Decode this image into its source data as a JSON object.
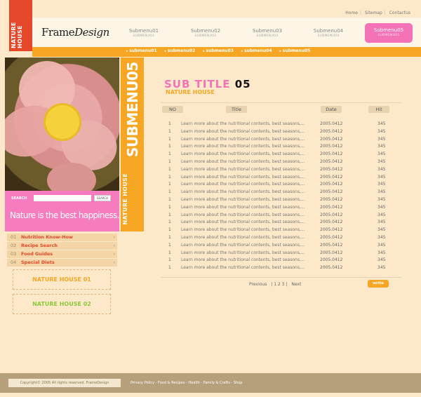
{
  "top_links": [
    "Home",
    "Sitemap",
    "Contactus"
  ],
  "brand_vertical": "NATURE HOUSE",
  "logo": {
    "part1": "Frame",
    "part2": "Design"
  },
  "nav": [
    {
      "label": "Submenu01",
      "sub": "SUBMENU01"
    },
    {
      "label": "Submenu02",
      "sub": "SUBMENU02"
    },
    {
      "label": "Submenu03",
      "sub": "SUBMENU03"
    },
    {
      "label": "Submenu04",
      "sub": "SUBMENU04"
    },
    {
      "label": "Submenu05",
      "sub": "SUBMENU05"
    }
  ],
  "subnav": [
    "submenu01",
    "submenu02",
    "submenu03",
    "submenu04",
    "submenu05"
  ],
  "search": {
    "label": "SEARCH",
    "button": "SEARCH",
    "placeholder": ""
  },
  "tagline": "Nature is the best happiness.",
  "side_banner": {
    "big": "SUBMENU05",
    "small": "NATURE HOUSE"
  },
  "left_menu": [
    {
      "num": "01",
      "label": "Nutrition Know-How"
    },
    {
      "num": "02",
      "label": "Recipe Search"
    },
    {
      "num": "03",
      "label": "Food Guides"
    },
    {
      "num": "04",
      "label": "Special Diets"
    }
  ],
  "nature_boxes": [
    "NATURE HOUSE 01",
    "NATURE HOUSE 02"
  ],
  "main": {
    "title_prefix": "SUB TITLE",
    "title_num": "05",
    "subtitle": "NATURE HOUSE",
    "columns": [
      "NO",
      "Title",
      "Date",
      "Hit"
    ],
    "rows": [
      {
        "no": "1",
        "title": "Learn more about the nutritional contents, best seasons,...",
        "date": "2005.0412",
        "hit": "345"
      },
      {
        "no": "1",
        "title": "Learn more about the nutritional contents, best seasons,...",
        "date": "2005.0412",
        "hit": "345"
      },
      {
        "no": "1",
        "title": "Learn more about the nutritional contents, best seasons,...",
        "date": "2005.0412",
        "hit": "345"
      },
      {
        "no": "1",
        "title": "Learn more about the nutritional contents, best seasons,...",
        "date": "2005.0412",
        "hit": "345"
      },
      {
        "no": "1",
        "title": "Learn more about the nutritional contents, best seasons,...",
        "date": "2005.0412",
        "hit": "345"
      },
      {
        "no": "1",
        "title": "Learn more about the nutritional contents, best seasons,...",
        "date": "2005.0412",
        "hit": "345"
      },
      {
        "no": "1",
        "title": "Learn more about the nutritional contents, best seasons,...",
        "date": "2005.0412",
        "hit": "345"
      },
      {
        "no": "1",
        "title": "Learn more about the nutritional contents, best seasons,...",
        "date": "2005.0412",
        "hit": "345"
      },
      {
        "no": "1",
        "title": "Learn more about the nutritional contents, best seasons,...",
        "date": "2005.0412",
        "hit": "345"
      },
      {
        "no": "1",
        "title": "Learn more about the nutritional contents, best seasons,...",
        "date": "2005.0412",
        "hit": "345"
      },
      {
        "no": "1",
        "title": "Learn more about the nutritional contents, best seasons,...",
        "date": "2005.0412",
        "hit": "345"
      },
      {
        "no": "1",
        "title": "Learn more about the nutritional contents, best seasons,...",
        "date": "2005.0412",
        "hit": "345"
      },
      {
        "no": "1",
        "title": "Learn more about the nutritional contents, best seasons,...",
        "date": "2005.0412",
        "hit": "345"
      },
      {
        "no": "1",
        "title": "Learn more about the nutritional contents, best seasons,...",
        "date": "2005.0412",
        "hit": "345"
      },
      {
        "no": "1",
        "title": "Learn more about the nutritional contents, best seasons,...",
        "date": "2005.0412",
        "hit": "345"
      },
      {
        "no": "1",
        "title": "Learn more about the nutritional contents, best seasons,...",
        "date": "2005.0412",
        "hit": "345"
      },
      {
        "no": "1",
        "title": "Learn more about the nutritional contents, best seasons,...",
        "date": "2005.0412",
        "hit": "345"
      },
      {
        "no": "1",
        "title": "Learn more about the nutritional contents, best seasons,...",
        "date": "2005.0412",
        "hit": "345"
      },
      {
        "no": "1",
        "title": "Learn more about the nutritional contents, best seasons,...",
        "date": "2005.0412",
        "hit": "345"
      },
      {
        "no": "1",
        "title": "Learn more about the nutritional contents, best seasons,...",
        "date": "2005.0412",
        "hit": "345"
      }
    ],
    "paging": {
      "prev": "Previous",
      "pages": "| 1 2 3 |",
      "next": "Next"
    },
    "write_button": "write"
  },
  "footer": {
    "copyright": "Copyright© 2005 All rights reserved. FrameDesign",
    "links": "Privacy Policy - Food & Recipes - Health - Family & Crafts - Shop"
  },
  "colors": {
    "accent_orange": "#f6a623",
    "accent_pink": "#f472b6",
    "accent_red": "#e4472a",
    "background": "#fde9c9"
  }
}
